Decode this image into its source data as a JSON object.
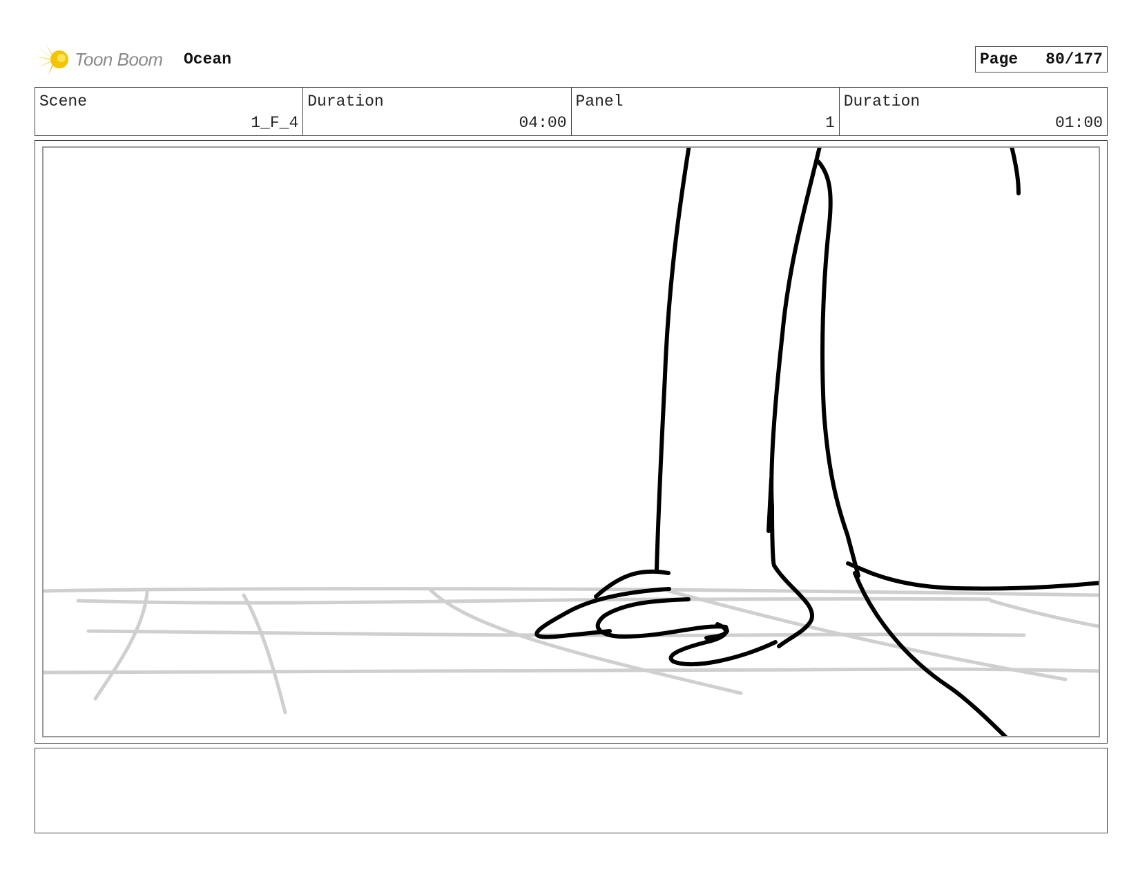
{
  "header": {
    "brand": "Toon Boom",
    "project": "Ocean",
    "page_label": "Page",
    "page_value": "80/177",
    "logo_icon": "starburst-icon",
    "logo_color": "#f5c400"
  },
  "info": {
    "scene": {
      "label": "Scene",
      "value": "1_F_4"
    },
    "scene_duration": {
      "label": "Duration",
      "value": "04:00"
    },
    "panel": {
      "label": "Panel",
      "value": "1"
    },
    "panel_duration": {
      "label": "Duration",
      "value": "01:00"
    }
  },
  "notes": {
    "text": ""
  },
  "colors": {
    "sketch_line": "#000000",
    "grid_line": "#cfcfcf"
  }
}
